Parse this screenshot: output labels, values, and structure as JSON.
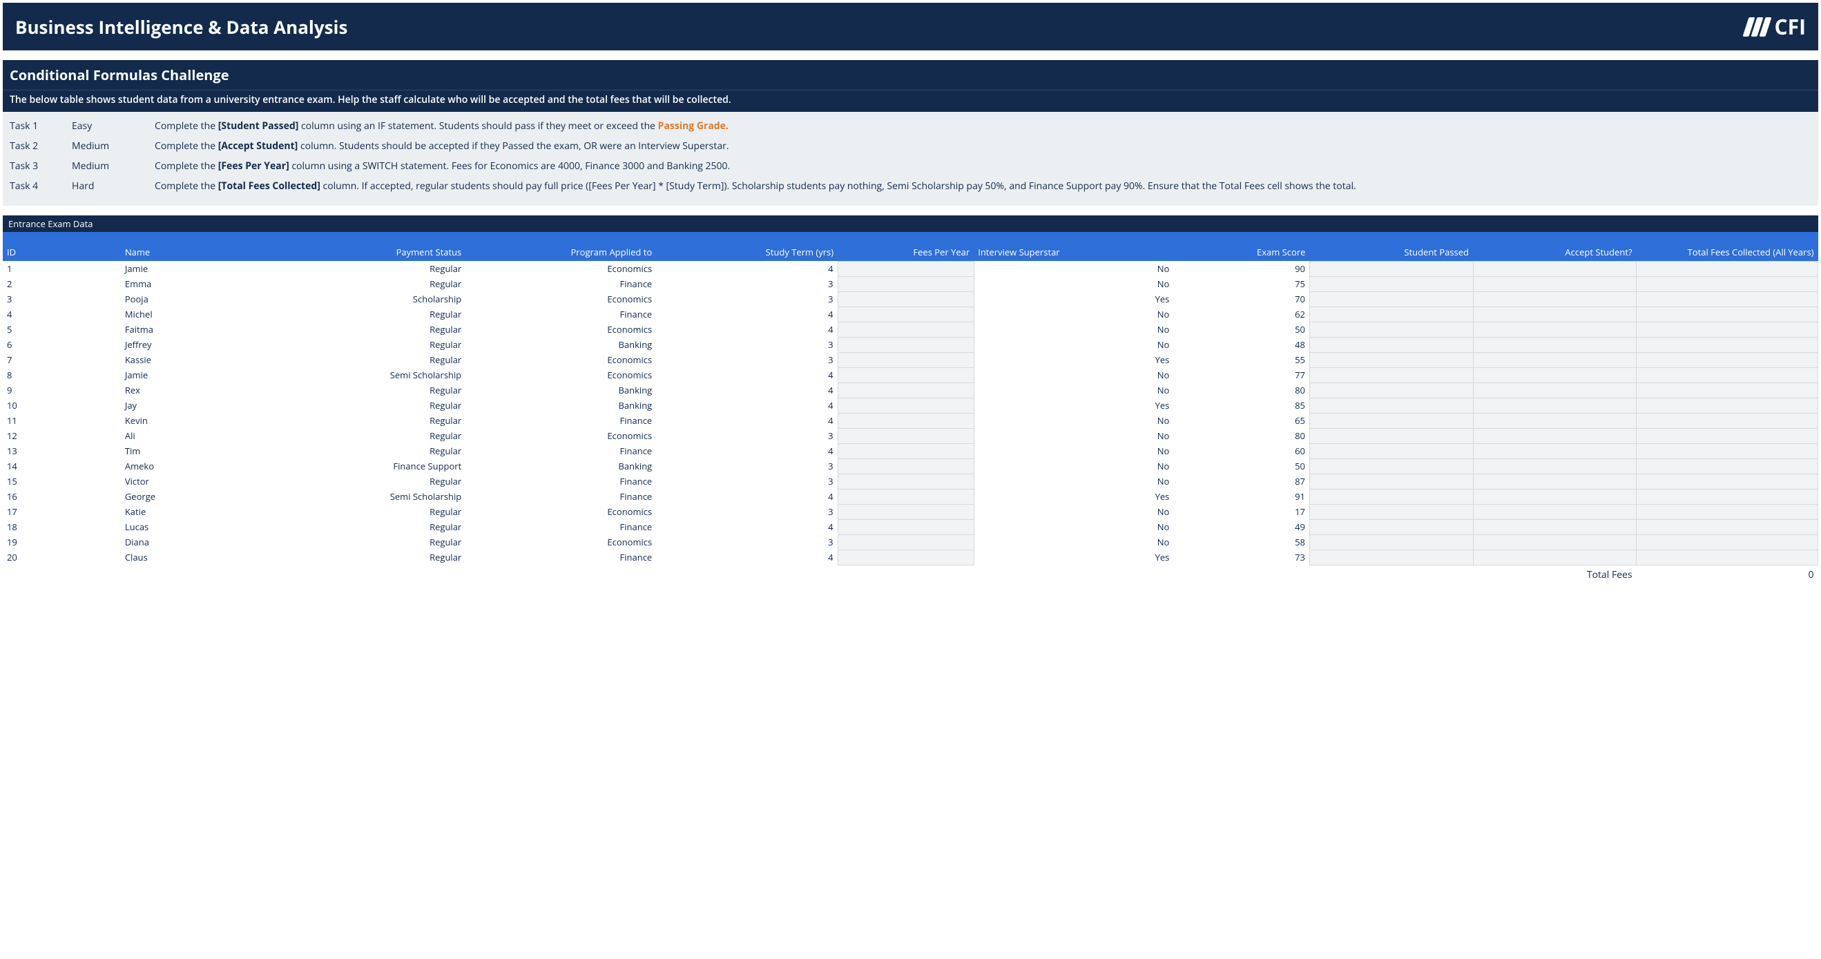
{
  "title": "Business Intelligence & Data Analysis",
  "logo_text": "CFI",
  "section": {
    "heading": "Conditional Formulas Challenge",
    "subheading": "The below table shows student data from a university entrance exam. Help the staff calculate who will be accepted and the total fees that will be collected."
  },
  "tasks": [
    {
      "label": "Task 1",
      "difficulty": "Easy",
      "desc_pre": "Complete the ",
      "desc_bold": "[Student Passed]",
      "desc_mid": " column using an IF statement. Students should pass if they meet or exceed the ",
      "desc_orange": "Passing Grade.",
      "desc_post": ""
    },
    {
      "label": "Task 2",
      "difficulty": "Medium",
      "desc_pre": "Complete the ",
      "desc_bold": "[Accept Student]",
      "desc_mid": " column. Students should be accepted if they Passed the exam, OR were an Interview Superstar.",
      "desc_orange": "",
      "desc_post": ""
    },
    {
      "label": "Task 3",
      "difficulty": "Medium",
      "desc_pre": "Complete the ",
      "desc_bold": "[Fees Per Year]",
      "desc_mid": " column using a SWITCH statement. Fees for Economics are 4000, Finance 3000 and Banking 2500.",
      "desc_orange": "",
      "desc_post": ""
    },
    {
      "label": "Task 4",
      "difficulty": "Hard",
      "desc_pre": "Complete the ",
      "desc_bold": "[Total Fees Collected]",
      "desc_mid": " column. If accepted, regular students should pay full price ([Fees Per Year] * [Study Term]). Scholarship students pay nothing, Semi Scholarship pay 50%, and Finance Support pay 90%. Ensure that the Total Fees cell shows the total.",
      "desc_orange": "",
      "desc_post": ""
    }
  ],
  "table": {
    "title": "Entrance Exam Data",
    "headers": {
      "id": "ID",
      "name": "Name",
      "payment": "Payment Status",
      "program": "Program Applied to",
      "term": "Study Term (yrs)",
      "fees": "Fees Per Year",
      "superstar": "Interview Superstar",
      "score": "Exam Score",
      "passed": "Student Passed",
      "accept": "Accept Student?",
      "total": "Total Fees Collected (All Years)"
    },
    "rows": [
      {
        "id": "1",
        "name": "Jamie",
        "payment": "Regular",
        "program": "Economics",
        "term": "4",
        "fees": "",
        "superstar": "No",
        "score": "90",
        "passed": "",
        "accept": "",
        "total": ""
      },
      {
        "id": "2",
        "name": "Emma",
        "payment": "Regular",
        "program": "Finance",
        "term": "3",
        "fees": "",
        "superstar": "No",
        "score": "75",
        "passed": "",
        "accept": "",
        "total": ""
      },
      {
        "id": "3",
        "name": "Pooja",
        "payment": "Scholarship",
        "program": "Economics",
        "term": "3",
        "fees": "",
        "superstar": "Yes",
        "score": "70",
        "passed": "",
        "accept": "",
        "total": ""
      },
      {
        "id": "4",
        "name": "Michel",
        "payment": "Regular",
        "program": "Finance",
        "term": "4",
        "fees": "",
        "superstar": "No",
        "score": "62",
        "passed": "",
        "accept": "",
        "total": ""
      },
      {
        "id": "5",
        "name": "Faitma",
        "payment": "Regular",
        "program": "Economics",
        "term": "4",
        "fees": "",
        "superstar": "No",
        "score": "50",
        "passed": "",
        "accept": "",
        "total": ""
      },
      {
        "id": "6",
        "name": "Jeffrey",
        "payment": "Regular",
        "program": "Banking",
        "term": "3",
        "fees": "",
        "superstar": "No",
        "score": "48",
        "passed": "",
        "accept": "",
        "total": ""
      },
      {
        "id": "7",
        "name": "Kassie",
        "payment": "Regular",
        "program": "Economics",
        "term": "3",
        "fees": "",
        "superstar": "Yes",
        "score": "55",
        "passed": "",
        "accept": "",
        "total": ""
      },
      {
        "id": "8",
        "name": "Jamie",
        "payment": "Semi Scholarship",
        "program": "Economics",
        "term": "4",
        "fees": "",
        "superstar": "No",
        "score": "77",
        "passed": "",
        "accept": "",
        "total": ""
      },
      {
        "id": "9",
        "name": "Rex",
        "payment": "Regular",
        "program": "Banking",
        "term": "4",
        "fees": "",
        "superstar": "No",
        "score": "80",
        "passed": "",
        "accept": "",
        "total": ""
      },
      {
        "id": "10",
        "name": "Jay",
        "payment": "Regular",
        "program": "Banking",
        "term": "4",
        "fees": "",
        "superstar": "Yes",
        "score": "85",
        "passed": "",
        "accept": "",
        "total": ""
      },
      {
        "id": "11",
        "name": "Kevin",
        "payment": "Regular",
        "program": "Finance",
        "term": "4",
        "fees": "",
        "superstar": "No",
        "score": "65",
        "passed": "",
        "accept": "",
        "total": ""
      },
      {
        "id": "12",
        "name": "Ali",
        "payment": "Regular",
        "program": "Economics",
        "term": "3",
        "fees": "",
        "superstar": "No",
        "score": "80",
        "passed": "",
        "accept": "",
        "total": ""
      },
      {
        "id": "13",
        "name": "Tim",
        "payment": "Regular",
        "program": "Finance",
        "term": "4",
        "fees": "",
        "superstar": "No",
        "score": "60",
        "passed": "",
        "accept": "",
        "total": ""
      },
      {
        "id": "14",
        "name": "Ameko",
        "payment": "Finance Support",
        "program": "Banking",
        "term": "3",
        "fees": "",
        "superstar": "No",
        "score": "50",
        "passed": "",
        "accept": "",
        "total": ""
      },
      {
        "id": "15",
        "name": "Victor",
        "payment": "Regular",
        "program": "Finance",
        "term": "3",
        "fees": "",
        "superstar": "No",
        "score": "87",
        "passed": "",
        "accept": "",
        "total": ""
      },
      {
        "id": "16",
        "name": "George",
        "payment": "Semi Scholarship",
        "program": "Finance",
        "term": "4",
        "fees": "",
        "superstar": "Yes",
        "score": "91",
        "passed": "",
        "accept": "",
        "total": ""
      },
      {
        "id": "17",
        "name": "Katie",
        "payment": "Regular",
        "program": "Economics",
        "term": "3",
        "fees": "",
        "superstar": "No",
        "score": "17",
        "passed": "",
        "accept": "",
        "total": ""
      },
      {
        "id": "18",
        "name": "Lucas",
        "payment": "Regular",
        "program": "Finance",
        "term": "4",
        "fees": "",
        "superstar": "No",
        "score": "49",
        "passed": "",
        "accept": "",
        "total": ""
      },
      {
        "id": "19",
        "name": "Diana",
        "payment": "Regular",
        "program": "Economics",
        "term": "3",
        "fees": "",
        "superstar": "No",
        "score": "58",
        "passed": "",
        "accept": "",
        "total": ""
      },
      {
        "id": "20",
        "name": "Claus",
        "payment": "Regular",
        "program": "Finance",
        "term": "4",
        "fees": "",
        "superstar": "Yes",
        "score": "73",
        "passed": "",
        "accept": "",
        "total": ""
      }
    ],
    "footer": {
      "label": "Total Fees",
      "value": "0"
    }
  }
}
